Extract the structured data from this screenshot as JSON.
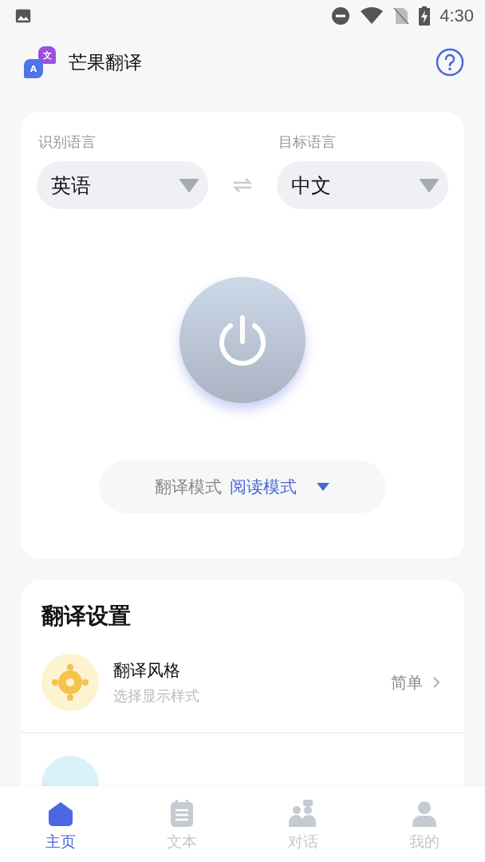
{
  "status_bar": {
    "time": "4:30"
  },
  "app": {
    "title": "芒果翻译",
    "logo_letters": [
      "文",
      "A"
    ]
  },
  "languages": {
    "source_label": "识别语言",
    "source": "英语",
    "target_label": "目标语言",
    "target": "中文"
  },
  "power": {
    "on": false
  },
  "mode": {
    "label": "翻译模式",
    "value": "阅读模式"
  },
  "settings": {
    "title": "翻译设置",
    "items": [
      {
        "kind": "style",
        "title": "翻译风格",
        "subtitle": "选择显示样式",
        "value": "简单"
      },
      {
        "kind": "method"
      }
    ]
  },
  "nav": [
    {
      "kind": "home",
      "label": "主页",
      "selected": true
    },
    {
      "kind": "text",
      "label": "文本",
      "selected": false
    },
    {
      "kind": "chat",
      "label": "对话",
      "selected": false
    },
    {
      "kind": "me",
      "label": "我的",
      "selected": false
    }
  ]
}
